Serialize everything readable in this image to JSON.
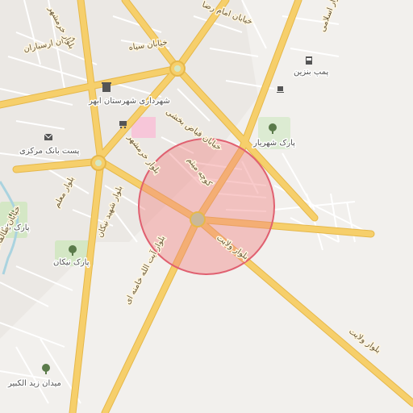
{
  "map": {
    "colors": {
      "background": "#f2f0ed",
      "major_road": "#f6cf6b",
      "major_road_casing": "#e6b84a",
      "minor_road": "#ffffff",
      "park": "#d4e7c5",
      "water": "#aad3df",
      "highlight_fill": "#f08080",
      "highlight_stroke": "#e06070",
      "pink_area": "#f7c6d9"
    },
    "places": {
      "municipality": "شهرداری شهرستان ابهر",
      "post_bank": "پست بانک مرکزی",
      "gas_station": "پمپ بنزین",
      "park_shahriar": "پارک شهریار",
      "park_banoo": "پارک بانو",
      "park_nikan": "پارک نیکان",
      "square_zeid": "میدان زید الکبیر"
    },
    "roads": {
      "siah": "خیابان سیاه",
      "arasbaran": "خیابان ارسباران",
      "khorramshahr_top": "بلوار خرمشهر",
      "imam_reza": "خیابان امام رضا",
      "bakhshi": "خیابان فیاض بخشی",
      "maalem": "بلوار معلم",
      "nikan": "بلوار شهید نیکان",
      "khorramshahr2": "بلوار خرمشهر",
      "kooche_meysam": "کوچه میثم",
      "velayat1": "بلوار ولایت",
      "velayat2": "بلوار ولایت",
      "khamenei": "بلوار آیت الله خامنه ای",
      "taleghani": "خیابان طالقانی",
      "islami": "بلوار اسلامی"
    }
  }
}
